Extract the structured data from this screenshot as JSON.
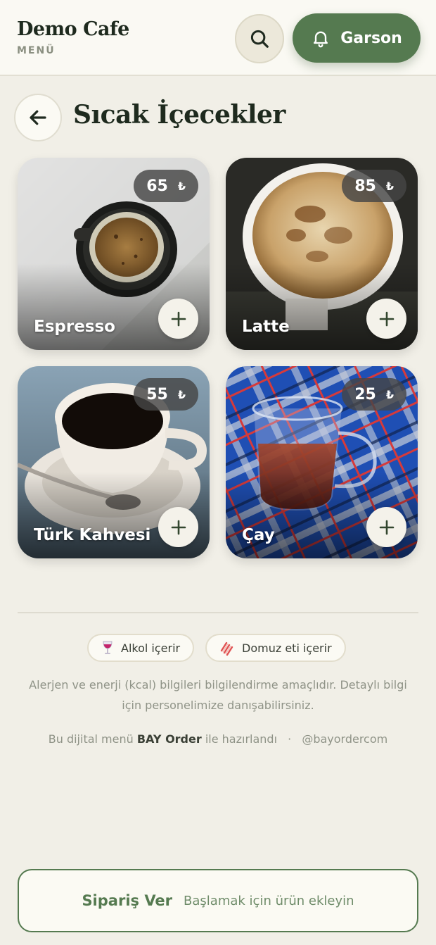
{
  "header": {
    "brand_name": "Demo Cafe",
    "brand_sub": "MENÜ",
    "waiter_label": "Garson"
  },
  "category": {
    "title": "Sıcak İçecekler"
  },
  "products": [
    {
      "name": "Espresso",
      "price": "65",
      "currency": "₺"
    },
    {
      "name": "Latte",
      "price": "85",
      "currency": "₺"
    },
    {
      "name": "Türk Kahvesi",
      "price": "55",
      "currency": "₺"
    },
    {
      "name": "Çay",
      "price": "25",
      "currency": "₺"
    }
  ],
  "legend": {
    "alcohol": "Alkol içerir",
    "pork": "Domuz eti içerir"
  },
  "info": "Alerjen ve enerji (kcal) bilgileri bilgilendirme amaçlıdır. Detaylı bilgi için personelimize danışabilirsiniz.",
  "credit": {
    "prefix": "Bu dijital menü",
    "brand": "BAY Order",
    "suffix": "ile hazırlandı",
    "separator": "·",
    "handle": "@bayordercom"
  },
  "order_bar": {
    "title": "Sipariş Ver",
    "subtitle": "Başlamak için ürün ekleyin"
  },
  "colors": {
    "accent": "#557a50",
    "background": "#f1efe7",
    "header_bg": "#faf9f3"
  }
}
